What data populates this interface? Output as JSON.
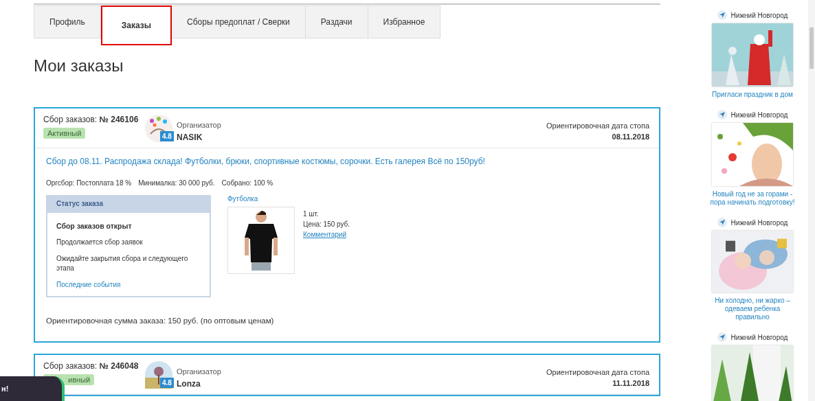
{
  "tabs": [
    {
      "label": "Профиль",
      "selected": false
    },
    {
      "label": "Заказы",
      "selected": true
    },
    {
      "label": "Сборы предоплат / Сверки",
      "selected": false
    },
    {
      "label": "Раздачи",
      "selected": false
    },
    {
      "label": "Избранное",
      "selected": false
    }
  ],
  "title": "Мои заказы",
  "orders": [
    {
      "number_label": "Сбор заказов:",
      "number": "№ 246106",
      "status": "Активный",
      "organizer_label": "Организатор",
      "organizer": "NASIK",
      "rating": "4.8",
      "stop_label": "Ориентировочная дата стопа",
      "stop_date": "08.11.2018",
      "description": "Сбор до 08.11. Распродажа склада! Футболки, брюки, спортивные костюмы, сорочки. Есть галерея Всё по 150руб!",
      "stats": [
        "Оргсбор: Постоплата 18 %",
        "Минималка: 30 000 руб.",
        "Собрано: 100 %"
      ],
      "status_panel": {
        "title": "Статус заказа",
        "state": "Сбор заказов открыт",
        "lines": [
          "Продолжается сбор заявок",
          "Ожидайте закрытия сбора и следующего этапа"
        ],
        "link": "Последние события"
      },
      "items": [
        {
          "name": "Футболка",
          "qty": "1 шт.",
          "price": "Цена: 150 руб.",
          "comment": "Комментарий"
        }
      ],
      "total": "Ориентировочная сумма заказа: 150 руб. (по оптовым ценам)"
    },
    {
      "number_label": "Сбор заказов:",
      "number": "№ 246048",
      "status": "ивный",
      "organizer_label": "Организатор",
      "organizer": "Lonza",
      "rating": "4.8",
      "stop_label": "Ориентировочная дата стопа",
      "stop_date": "11.11.2018"
    }
  ],
  "sidebar": [
    {
      "location": "Нижний Новгород",
      "caption": "Пригласи праздник в дом"
    },
    {
      "location": "Нижний Новгород",
      "caption": "Новый год не за горами - пора начинать подготовку!"
    },
    {
      "location": "Нижний Новгород",
      "caption": "Ни холодно, ни жарко – одеваем ребенка правильно"
    },
    {
      "location": "Нижний Новгород"
    }
  ],
  "toast": {
    "text": "н!"
  }
}
